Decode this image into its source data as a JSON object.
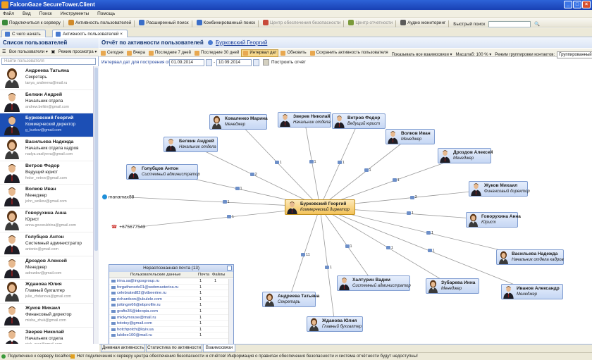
{
  "window": {
    "title": "FalconGaze SecureTower.Client"
  },
  "menu": [
    "Файл",
    "Вид",
    "Поиск",
    "Инструменты",
    "Помощь"
  ],
  "toolbar": {
    "items": [
      {
        "label": "Подключиться к серверу",
        "enabled": true,
        "color": "#3a8a3a"
      },
      {
        "label": "Активность пользователей",
        "enabled": true,
        "color": "#d08a2a"
      },
      {
        "label": "Расширенный поиск",
        "enabled": true,
        "color": "#3a6ec8"
      },
      {
        "label": "Комбинированный поиск",
        "enabled": true,
        "color": "#3a6ec8"
      },
      {
        "label": "Центр обеспечения безопасности",
        "enabled": false,
        "color": "#c84a3a"
      },
      {
        "label": "Центр отчетности",
        "enabled": false,
        "color": "#7a9a3a"
      },
      {
        "label": "Аудио мониторинг",
        "enabled": true,
        "color": "#5a5a5a"
      }
    ],
    "quick_search_label": "Быстрый поиск"
  },
  "tabs": [
    {
      "label": "С чего начать",
      "active": false
    },
    {
      "label": "Активность пользователей",
      "active": true
    }
  ],
  "left": {
    "title": "Список пользователей",
    "filter_label": "Все пользователи",
    "view_label": "Режим просмотра",
    "search_placeholder": "Найти пользователя",
    "users": [
      {
        "name": "Андреева Татьяна",
        "position": "Секретарь",
        "email": "tanya_andreeva@mail.ru",
        "gender": "f",
        "selected": false
      },
      {
        "name": "Белкин Андрей",
        "position": "Начальник отдела",
        "email": "andrew.belkin@gmail.com",
        "gender": "m",
        "selected": false
      },
      {
        "name": "Бурковский Георгий",
        "position": "Коммерческий директор",
        "email": "g_burkov@gmail.com",
        "gender": "m",
        "selected": true
      },
      {
        "name": "Васильева Надежда",
        "position": "Начальник отдела кадров",
        "email": "nadya.vasilyeva@gmail.com",
        "gender": "f",
        "selected": false
      },
      {
        "name": "Ветров Федор",
        "position": "Ведущий юрист",
        "email": "fedor_vetrov@gmail.com",
        "gender": "m",
        "selected": false
      },
      {
        "name": "Волков Иван",
        "position": "Менеджер",
        "email": "john_wolkov@gmail.com",
        "gender": "m",
        "selected": false
      },
      {
        "name": "Говорухина Анна",
        "position": "Юрист",
        "email": "anna-govorukhina@gmail.com",
        "gender": "f",
        "selected": false
      },
      {
        "name": "Голубцов Антон",
        "position": "Системный администратор",
        "email": "antonio@gmail.com",
        "gender": "m",
        "selected": false
      },
      {
        "name": "Дроздов Алексей",
        "position": "Менеджер",
        "email": "adrozdov@gmail.com",
        "gender": "m",
        "selected": false
      },
      {
        "name": "Жданова Юлия",
        "position": "Главный бухгалтер",
        "email": "julie_zhdanova@gmail.com",
        "gender": "f",
        "selected": false
      },
      {
        "name": "Жуков Михаил",
        "position": "Финансовый директор",
        "email": "misha_zhuk@gmail.com",
        "gender": "m",
        "selected": false
      },
      {
        "name": "Зверев Николай",
        "position": "Начальник отдела",
        "email": "nick_zver@gmail.com",
        "gender": "m",
        "selected": false
      }
    ]
  },
  "report": {
    "title": "Отчёт по активности пользователей",
    "user_link": "Бурковский Георгий",
    "tools": [
      {
        "label": "Сегодня",
        "on": false
      },
      {
        "label": "Вчера",
        "on": false
      },
      {
        "label": "Последние 7 дней",
        "on": false
      },
      {
        "label": "Последние 30 дней",
        "on": false
      },
      {
        "label": "Интервал дат",
        "on": true
      },
      {
        "label": "Обновить",
        "on": false
      },
      {
        "label": "Сохранить активность пользователя",
        "on": false
      }
    ],
    "show_all": "Показывать все взаимосвязи",
    "scale": "Масштаб: 100 %",
    "grouping_label": "Режим группировки контактов:",
    "grouping_value": "Группированный",
    "range_label": "Интервал дат для построения отчёта:",
    "date_from": "01.09.2014",
    "date_to": "10.09.2014",
    "build": "Построить отчёт"
  },
  "graph": {
    "center": {
      "name": "Бурковский Георгий",
      "position": "Коммерческий директор"
    },
    "nodes": [
      {
        "name": "Коваленко Марина",
        "position": "Менеджер",
        "gender": "f"
      },
      {
        "name": "Зверев Николай",
        "position": "Начальник отдела",
        "gender": "m"
      },
      {
        "name": "Ветров Федор",
        "position": "Ведущий юрист",
        "gender": "m"
      },
      {
        "name": "Волков Иван",
        "position": "Менеджер",
        "gender": "m"
      },
      {
        "name": "Белкин Андрей",
        "position": "Начальник отдела",
        "gender": "m"
      },
      {
        "name": "Дроздов Алексей",
        "position": "Менеджер",
        "gender": "m"
      },
      {
        "name": "Голубцов Антон",
        "position": "Системный администратор",
        "gender": "m"
      },
      {
        "name": "Жуков Михаил",
        "position": "Финансовый директор",
        "gender": "m"
      },
      {
        "name": "Говорухина Анна",
        "position": "Юрист",
        "gender": "f"
      },
      {
        "name": "Васильева Надежда",
        "position": "Начальник отдела кадров",
        "gender": "f"
      },
      {
        "name": "Халтурин Вадим",
        "position": "Системный администратор",
        "gender": "m"
      },
      {
        "name": "Зубарева Инна",
        "position": "Менеджер",
        "gender": "f"
      },
      {
        "name": "Иванов Александр",
        "position": "Менеджер",
        "gender": "m"
      },
      {
        "name": "Андреева Татьяна",
        "position": "Секретарь",
        "gender": "f"
      },
      {
        "name": "Жданова Юлия",
        "position": "Главный бухгалтер",
        "gender": "f"
      }
    ],
    "external": [
      {
        "label": "manamax88"
      },
      {
        "label": "+675677543"
      }
    ],
    "edge_labels": [
      "1",
      "1",
      "1",
      "1",
      "2",
      "1",
      "1",
      "3",
      "1",
      "1",
      "1",
      "1",
      "1",
      "11",
      "1",
      "1",
      "1"
    ],
    "unrecognized_mail": {
      "title": "Нераспознанная почта (13)",
      "col_user": "Пользовательские данные",
      "col_mail": "Почта",
      "col_files": "Файлы",
      "rows": [
        {
          "email": "irina.sa@ingosgroup.ru",
          "mail": "1",
          "files": "1"
        },
        {
          "email": "forgatheredv01@webmasterica.ru",
          "mail": "1",
          "files": ""
        },
        {
          "email": "celebrated82@vtbeerine.ru",
          "mail": "1",
          "files": ""
        },
        {
          "email": "richardson@ukulele.com",
          "mail": "1",
          "files": ""
        },
        {
          "email": "jottingm66@ebprofile.ru",
          "mail": "1",
          "files": ""
        },
        {
          "email": "grafts36@ideopia.com",
          "mail": "1",
          "files": ""
        },
        {
          "email": "mickymouse@mail.ru",
          "mail": "1",
          "files": ""
        },
        {
          "email": "tototoy@gmail.com",
          "mail": "1",
          "files": ""
        },
        {
          "email": "hotchpotch@kyiv.ua",
          "mail": "1",
          "files": ""
        },
        {
          "email": "lubilee100@mail.ru",
          "mail": "1",
          "files": ""
        }
      ]
    }
  },
  "bottom_tabs": [
    {
      "label": "Дневная активность",
      "active": false
    },
    {
      "label": "Статистика по активности",
      "active": false
    },
    {
      "label": "Взаимосвязи",
      "active": true
    }
  ],
  "status": {
    "connected": "Подключено к серверу localhost",
    "warning": "Нет подключения к серверу центра обеспечения безопасности и отчётов! Информация о правилах обеспечения безопасности и система отчётности будут недоступны!"
  },
  "colors": {
    "accent": "#1c4fb5",
    "center_node": "#f3c25a",
    "node": "#c6d7f4"
  }
}
